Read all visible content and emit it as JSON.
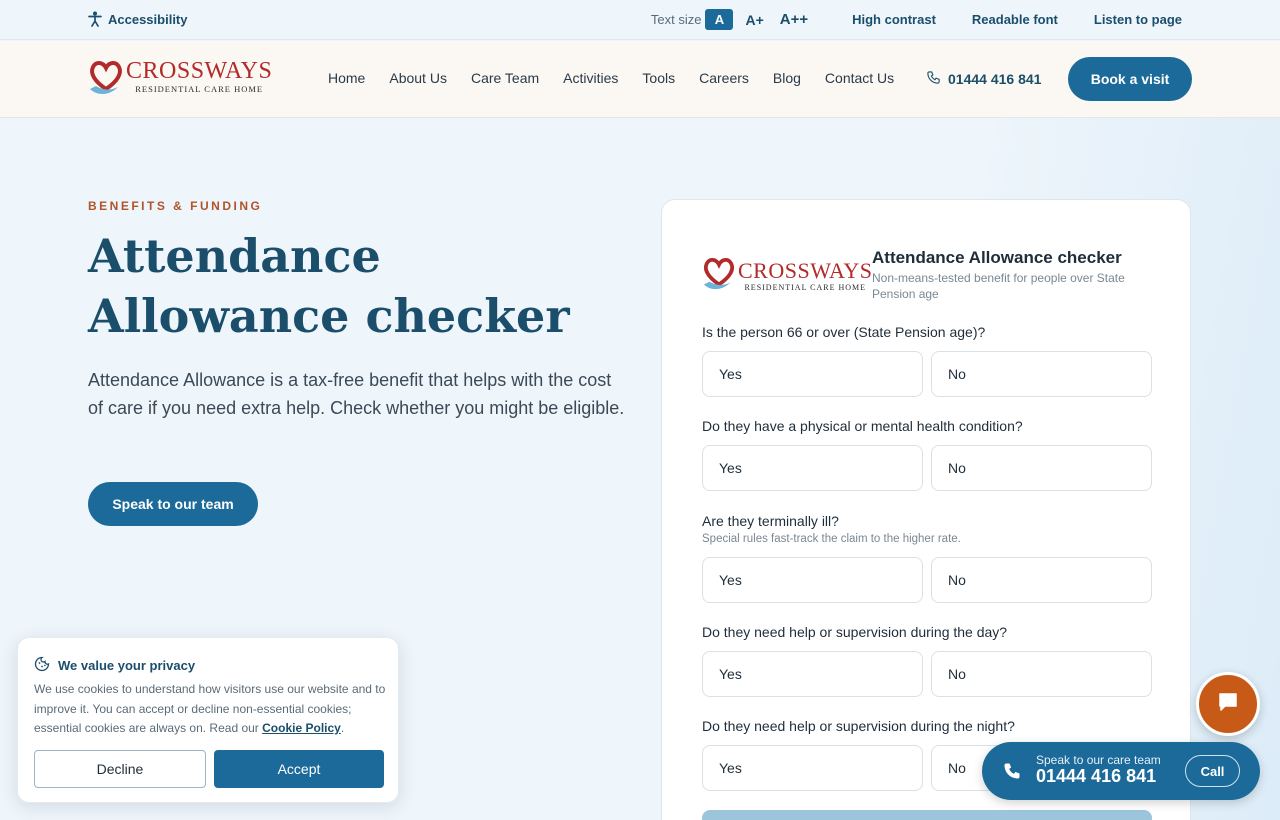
{
  "a11y": {
    "accessibility_label": "Accessibility",
    "text_size_label": "Text size",
    "size_a": "A",
    "size_a_plus": "A+",
    "size_a_plusplus": "A++",
    "high_contrast": "High contrast",
    "readable_font": "Readable font",
    "listen": "Listen to page"
  },
  "header": {
    "logo_name": "CROSSWAYS",
    "logo_sub": "RESIDENTIAL CARE HOME",
    "nav": [
      "Home",
      "About Us",
      "Care Team",
      "Activities",
      "Tools",
      "Careers",
      "Blog",
      "Contact Us"
    ],
    "phone": "01444 416 841",
    "book_label": "Book a visit"
  },
  "hero": {
    "eyebrow": "BENEFITS & FUNDING",
    "title": "Attendance Allowance checker",
    "text": "Attendance Allowance is a tax-free benefit that helps with the cost of care if you need extra help. Check whether you might be eligible.",
    "cta": "Speak to our team"
  },
  "checker": {
    "logo_name": "CROSSWAYS",
    "logo_sub": "RESIDENTIAL CARE HOME",
    "title": "Attendance Allowance checker",
    "subtitle": "Non-means-tested benefit for people over State Pension age",
    "yes_label": "Yes",
    "no_label": "No",
    "questions": [
      {
        "label": "Is the person 66 or over (State Pension age)?",
        "note": ""
      },
      {
        "label": "Do they have a physical or mental health condition?",
        "note": ""
      },
      {
        "label": "Are they terminally ill?",
        "note": "Special rules fast-track the claim to the higher rate."
      },
      {
        "label": "Do they need help or supervision during the day?",
        "note": ""
      },
      {
        "label": "Do they need help or supervision during the night?",
        "note": ""
      }
    ]
  },
  "cookie": {
    "title": "We value your privacy",
    "body": "We use cookies to understand how visitors use our website and to improve it. You can accept or decline non-essential cookies; essential cookies are always on. Read our",
    "policy_link": "Cookie Policy",
    "decline": "Decline",
    "accept": "Accept"
  },
  "call": {
    "small": "Speak to our care team",
    "number": "01444 416 841",
    "button": "Call"
  },
  "colors": {
    "primary": "#1b6a9a",
    "heading": "#1b4e6b",
    "accent_orange": "#c85a18",
    "logo_red": "#b22a2a"
  }
}
